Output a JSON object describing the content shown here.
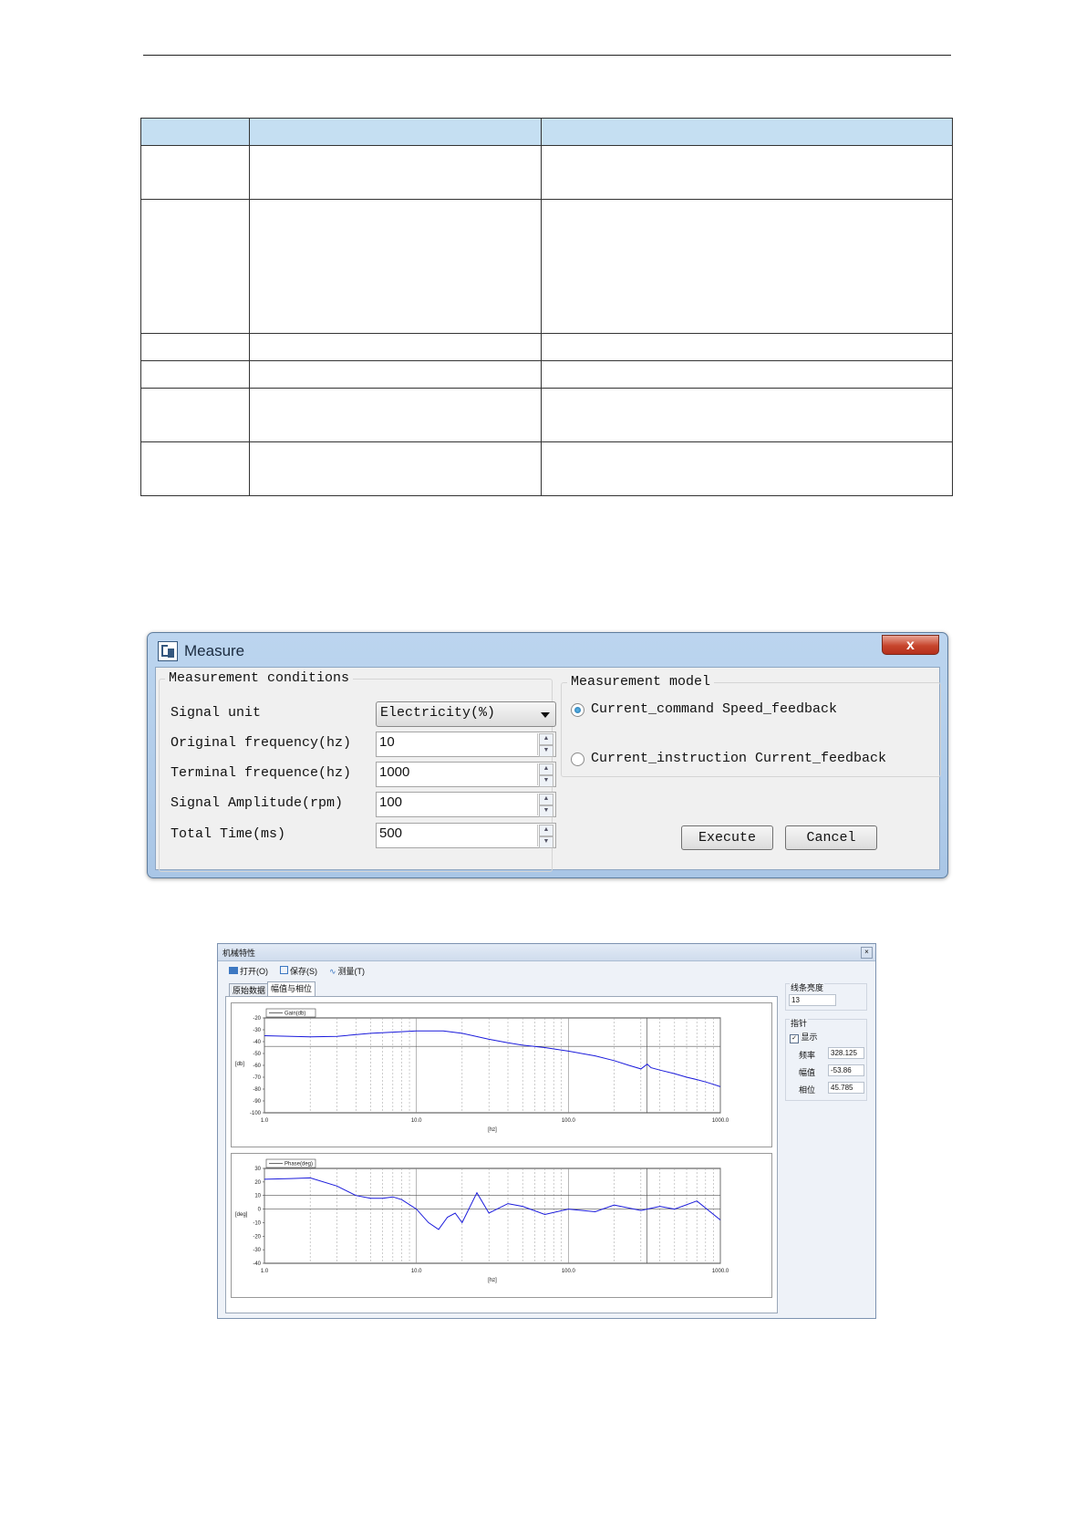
{
  "measure": {
    "title": "Measure",
    "close": "x",
    "conditions_legend": "Measurement conditions",
    "signal_unit_label": "Signal unit",
    "signal_unit_value": "Electricity(%)",
    "orig_freq_label": "Original frequency(hz)",
    "orig_freq_value": "10",
    "term_freq_label": "Terminal frequence(hz)",
    "term_freq_value": "1000",
    "amp_label": "Signal Amplitude(rpm)",
    "amp_value": "100",
    "time_label": "Total Time(ms)",
    "time_value": "500",
    "model_legend": "Measurement model",
    "model_opt1": "Current_command Speed_feedback",
    "model_opt2": "Current_instruction Current_feedback",
    "selected_model": 1,
    "execute": "Execute",
    "cancel": "Cancel"
  },
  "mech": {
    "title": "机械特性",
    "toolbar": [
      "打开(O)",
      "保存(S)",
      "测量(T)"
    ],
    "tabs": [
      "原始数据",
      "幅值与相位"
    ],
    "active_tab": 1,
    "side": {
      "brightness_label": "线条亮度",
      "brightness_value": "13",
      "pointer_label": "指针",
      "show_label": "显示",
      "freq_label": "频率",
      "freq_value": "328.125",
      "amp_label": "幅值",
      "amp_value": "-53.86",
      "phase_label": "相位",
      "phase_value": "45.785"
    },
    "colors": {
      "trace": "#1a1adb"
    }
  },
  "chart_data": [
    {
      "type": "line",
      "legend": "Gain(db)",
      "ylabel": "[db]",
      "xlabel": "[hz]",
      "xscale": "log",
      "xlim": [
        1,
        1000
      ],
      "ylim": [
        -100,
        -20
      ],
      "xticks": [
        "1.0",
        "10.0",
        "100.0",
        "1000.0"
      ],
      "yticks": [
        "-20",
        "-30",
        "-40",
        "-50",
        "-60",
        "-70",
        "-80",
        "-90",
        "-100"
      ],
      "cursor_x": 328.125,
      "series": [
        {
          "x": [
            1,
            2,
            3,
            5,
            7,
            10,
            15,
            20,
            30,
            40,
            50,
            70,
            100,
            150,
            200,
            250,
            300,
            330,
            350,
            400,
            500,
            600,
            700,
            800,
            900,
            1000
          ],
          "y": [
            -35,
            -36,
            -35.5,
            -33,
            -32,
            -31,
            -31,
            -33,
            -38,
            -41,
            -43,
            -45,
            -48,
            -52,
            -56,
            -60,
            -63,
            -59,
            -62,
            -64,
            -67,
            -70,
            -72,
            -74,
            -76,
            -78
          ]
        }
      ]
    },
    {
      "type": "line",
      "legend": "Phase(deg)",
      "ylabel": "[deg]",
      "xlabel": "[hz]",
      "xscale": "log",
      "xlim": [
        1,
        1000
      ],
      "ylim": [
        -40,
        30
      ],
      "xticks": [
        "1.0",
        "10.0",
        "100.0",
        "1000.0"
      ],
      "yticks": [
        "30",
        "20",
        "10",
        "0",
        "-10",
        "-20",
        "-30",
        "-40"
      ],
      "cursor_x": 328.125,
      "series": [
        {
          "x": [
            1,
            1.5,
            2,
            3,
            4,
            5,
            6,
            7,
            8,
            10,
            12,
            14,
            16,
            18,
            20,
            25,
            30,
            40,
            50,
            70,
            100,
            150,
            200,
            300,
            400,
            500,
            700,
            1000
          ],
          "y": [
            22,
            22.5,
            23,
            17,
            10,
            8,
            8,
            9,
            7,
            0,
            -10,
            -15,
            -6,
            -3,
            -10,
            12,
            -3,
            4,
            2,
            -4,
            0,
            -2,
            3,
            -1,
            2,
            0,
            6,
            -8
          ]
        }
      ]
    }
  ]
}
